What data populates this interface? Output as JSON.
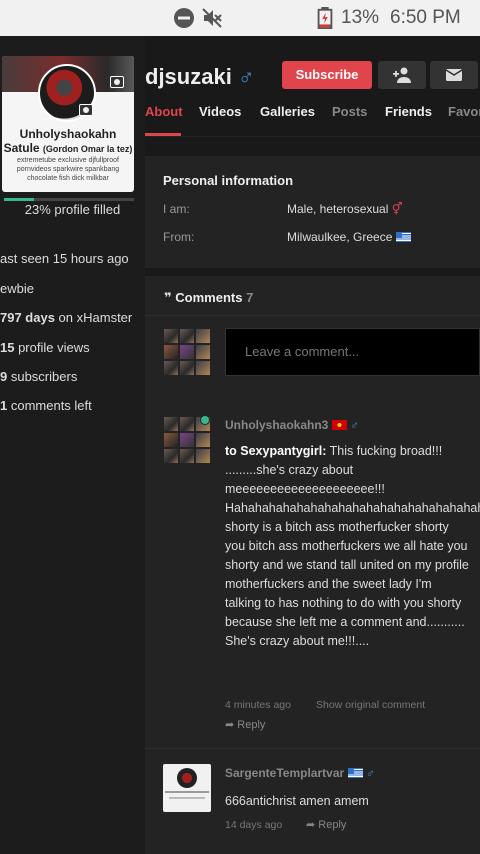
{
  "status_bar": {
    "battery": "13%",
    "time": "6:50 PM"
  },
  "profile": {
    "username": "djsuzaki",
    "card_name": "Unholyshaokahn Satule",
    "card_subname": "(Gordon Omar la tez)",
    "card_tags": "extremetube exclusive djfullproof pornvideos sparkwire spankbang chocolate fish dick milkbar",
    "progress_percent": 23,
    "progress_text": "23% profile filled",
    "stats": {
      "last_seen": "ast seen 15 hours ago",
      "rank": "ewbie",
      "days_value": "797 days",
      "days_suffix": " on xHamster",
      "views_value": "15",
      "views_suffix": " profile views",
      "subs_value": "9",
      "subs_suffix": " subscribers",
      "comments_value": "1",
      "comments_suffix": " comments left"
    }
  },
  "header": {
    "subscribe_label": "Subscribe",
    "gender_symbol": "♂"
  },
  "tabs": [
    "About",
    "Videos",
    "Galleries",
    "Posts",
    "Friends",
    "Favor"
  ],
  "personal_info": {
    "title": "Personal information",
    "i_am_label": "I am:",
    "i_am_value": "Male, heterosexual",
    "from_label": "From:",
    "from_value": "Milwaulkee, Greece"
  },
  "comments": {
    "title": "Comments",
    "count": "7",
    "placeholder": "Leave a comment...",
    "items": [
      {
        "author": "Unholyshaokahn3",
        "reply_to": "to Sexypantygirl:",
        "text": " This fucking broad!!! .........she's crazy about meeeeeeeeeeeeeeeeeeee!!! Hahahahahahahahahahahahahahahahahahahahahahahahahahahahahagsjahah shorty is a bitch ass motherfucker shorty you bitch ass motherfuckers we all hate you shorty and we stand tall united on my profile motherfuckers and the sweet lady I'm talking to has nothing to do with you shorty because she left me a comment and........... She's crazy about me!!!....",
        "time": "4 minutes ago",
        "show_original": "Show original comment",
        "reply": "Reply"
      },
      {
        "author": "SargenteTemplartvar",
        "text": "666antichrist amen amem",
        "time": "14 days ago",
        "reply": "Reply"
      }
    ]
  },
  "colors": {
    "accent": "#e0454d",
    "male_blue": "#3c8ed8",
    "online_green": "#35b88e"
  }
}
